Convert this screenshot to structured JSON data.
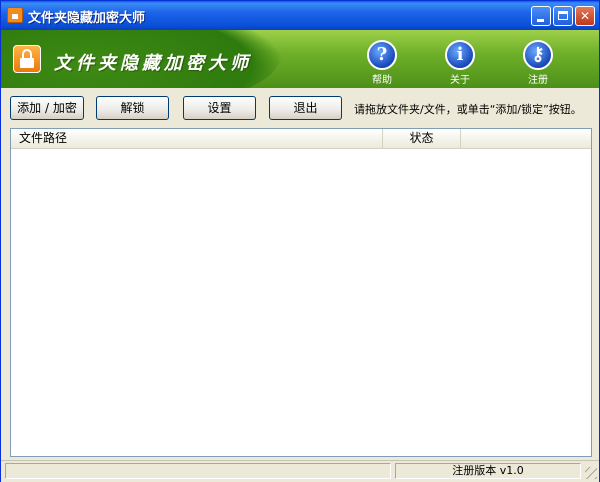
{
  "window": {
    "title": "文件夹隐藏加密大师"
  },
  "banner": {
    "title": "文件夹隐藏加密大师"
  },
  "tools": [
    {
      "label": "帮助",
      "icon": "?"
    },
    {
      "label": "关于",
      "icon": "i"
    },
    {
      "label": "注册",
      "icon": "⚷"
    }
  ],
  "toolbar": {
    "add_label": "添加 / 加密",
    "unlock_label": "解锁",
    "settings_label": "设置",
    "exit_label": "退出",
    "hint": "请拖放文件夹/文件，或单击“添加/锁定”按钮。"
  },
  "list": {
    "columns": [
      "文件路径",
      "状态"
    ]
  },
  "statusbar": {
    "left": "",
    "version": "注册版本 v1.0"
  },
  "colors": {
    "title_bar": "#1c64e8",
    "banner_green": "#6fb02a",
    "close_red": "#c0381c"
  }
}
